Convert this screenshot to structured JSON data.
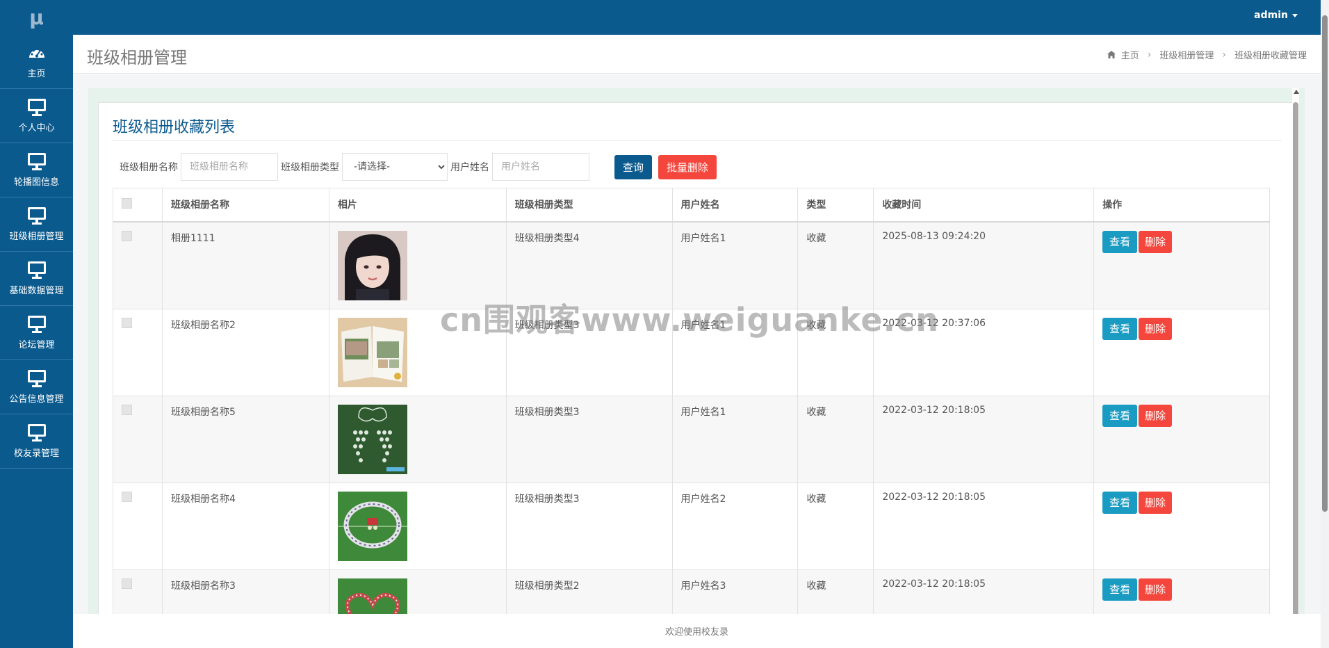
{
  "app": {
    "logo": "μ",
    "user": "admin"
  },
  "sidebar": {
    "items": [
      {
        "label": "主页",
        "icon": "dashboard-icon"
      },
      {
        "label": "个人中心",
        "icon": "monitor-icon"
      },
      {
        "label": "轮播图信息",
        "icon": "monitor-icon"
      },
      {
        "label": "班级相册管理",
        "icon": "monitor-icon"
      },
      {
        "label": "基础数据管理",
        "icon": "monitor-icon"
      },
      {
        "label": "论坛管理",
        "icon": "monitor-icon"
      },
      {
        "label": "公告信息管理",
        "icon": "monitor-icon"
      },
      {
        "label": "校友录管理",
        "icon": "monitor-icon"
      }
    ]
  },
  "header": {
    "title": "班级相册管理",
    "breadcrumb": [
      "主页",
      "班级相册管理",
      "班级相册收藏管理"
    ]
  },
  "card": {
    "title": "班级相册收藏列表"
  },
  "search": {
    "name_label": "班级相册名称",
    "name_placeholder": "班级相册名称",
    "type_label": "班级相册类型",
    "type_selected": "-请选择-",
    "user_label": "用户姓名",
    "user_placeholder": "用户姓名",
    "query_button": "查询",
    "batch_delete_button": "批量删除"
  },
  "table": {
    "columns": [
      "班级相册名称",
      "相片",
      "班级相册类型",
      "用户姓名",
      "类型",
      "收藏时间",
      "操作"
    ],
    "rows": [
      {
        "name": "相册1111",
        "type": "班级相册类型4",
        "user": "用户姓名1",
        "kind": "收藏",
        "time": "2025-08-13 09:24:20",
        "photo": "portrait"
      },
      {
        "name": "班级相册名称2",
        "type": "班级相册类型3",
        "user": "用户姓名1",
        "kind": "收藏",
        "time": "2022-03-12 20:37:06",
        "photo": "album-book"
      },
      {
        "name": "班级相册名称5",
        "type": "班级相册类型3",
        "user": "用户姓名1",
        "kind": "收藏",
        "time": "2022-03-12 20:18:05",
        "photo": "grapes-formation"
      },
      {
        "name": "班级相册名称4",
        "type": "班级相册类型3",
        "user": "用户姓名2",
        "kind": "收藏",
        "time": "2022-03-12 20:18:05",
        "photo": "circle-formation"
      },
      {
        "name": "班级相册名称3",
        "type": "班级相册类型2",
        "user": "用户姓名3",
        "kind": "收藏",
        "time": "2022-03-12 20:18:05",
        "photo": "heart-formation"
      }
    ],
    "view_label": "查看",
    "delete_label": "删除"
  },
  "watermark": "cn围观客www.weiguanke.cn",
  "footer": {
    "text": "欢迎使用校友录"
  },
  "colors": {
    "primary": "#0b5a8e",
    "danger": "#f4463c",
    "info": "#1a9bc2"
  }
}
